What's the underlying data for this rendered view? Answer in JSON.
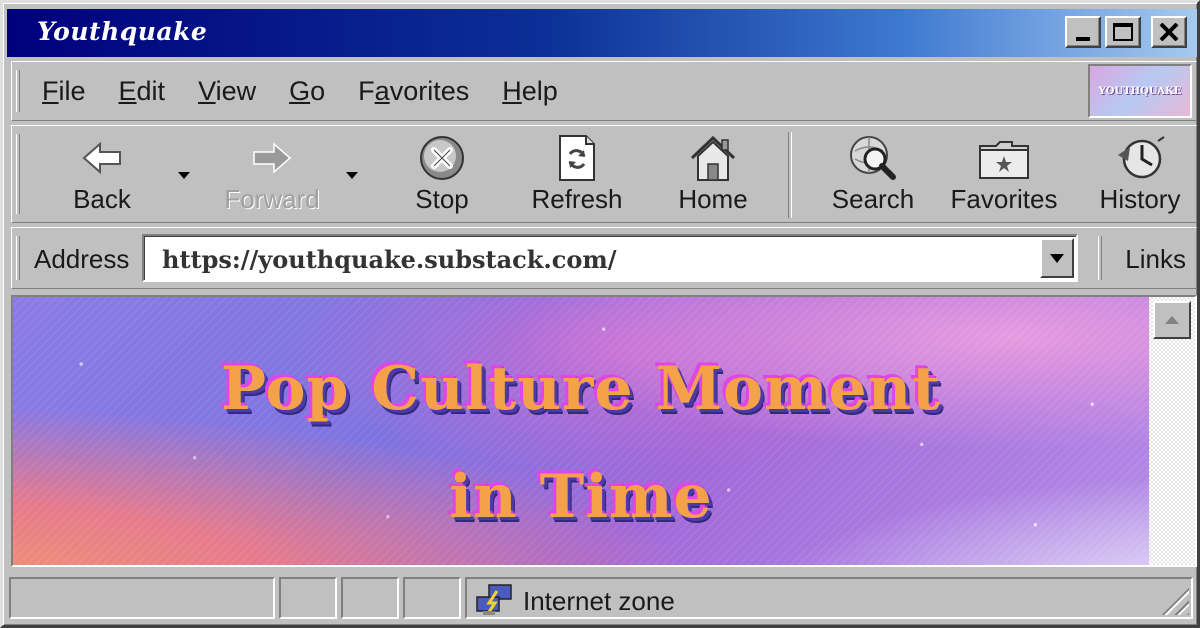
{
  "window": {
    "title": "Youthquake"
  },
  "menubar": {
    "items": [
      {
        "accel": "F",
        "rest": "ile"
      },
      {
        "accel": "E",
        "rest": "dit"
      },
      {
        "accel": "V",
        "rest": "iew"
      },
      {
        "accel": "G",
        "rest": "o"
      },
      {
        "pre": "F",
        "accel": "a",
        "rest": "vorites"
      },
      {
        "accel": "H",
        "rest": "elp"
      }
    ],
    "throbber_text": "YOUTHQUAKE"
  },
  "toolbar": {
    "back": "Back",
    "forward": "Forward",
    "stop": "Stop",
    "refresh": "Refresh",
    "home": "Home",
    "search": "Search",
    "favorites": "Favorites",
    "history": "History"
  },
  "address": {
    "label": "Address",
    "url": "https://youthquake.substack.com/",
    "links": "Links"
  },
  "banner": {
    "line1": "Pop Culture Moment",
    "line2": "in Time"
  },
  "statusbar": {
    "zone": "Internet zone"
  },
  "icons": {
    "back": "back-arrow-icon",
    "forward": "forward-arrow-icon",
    "stop": "stop-icon",
    "refresh": "refresh-icon",
    "home": "home-icon",
    "search": "search-icon",
    "favorites": "favorites-folder-icon",
    "history": "history-clock-icon",
    "zone": "internet-zone-icon"
  },
  "colors": {
    "titlebar_start": "#00007c",
    "titlebar_end": "#a6caf0",
    "chrome": "#c0c0c0",
    "banner_text": "#f4a24a"
  }
}
